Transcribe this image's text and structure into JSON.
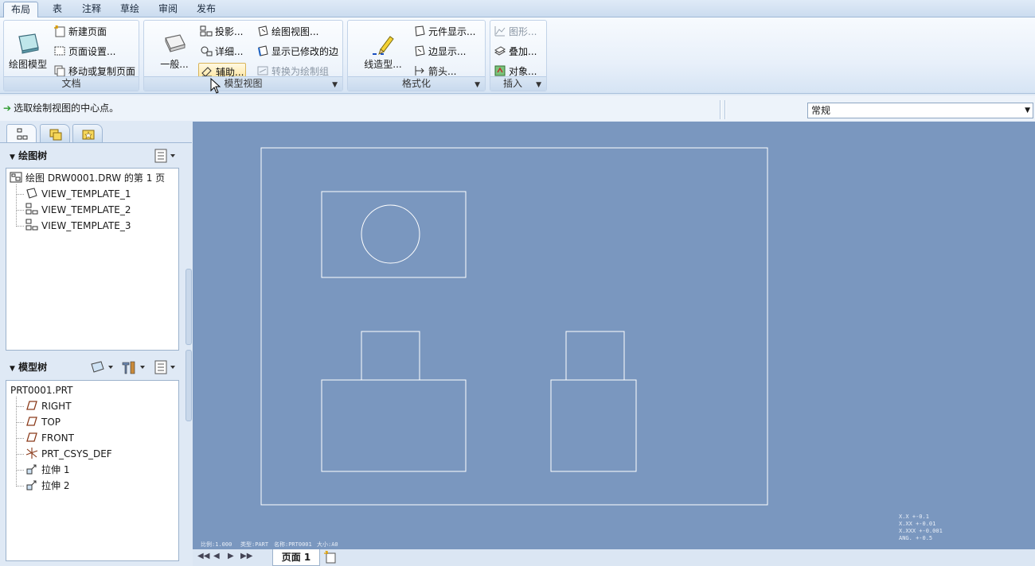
{
  "tabs": [
    "布局",
    "表",
    "注释",
    "草绘",
    "审阅",
    "发布"
  ],
  "ribbon": {
    "document": {
      "label": "文档",
      "big_button": "绘图模型",
      "new_page": "新建页面",
      "page_setup": "页面设置...",
      "move_copy_page": "移动或复制页面"
    },
    "model_views": {
      "label": "模型视图",
      "general": "一般...",
      "projection": "投影...",
      "detailed": "详细...",
      "auxiliary": "辅助...",
      "drawing_view": "绘图视图...",
      "show_modified_edges": "显示已修改的边",
      "convert_to_draft": "转换为绘制组"
    },
    "format": {
      "label": "格式化",
      "line_style": "线造型...",
      "component_display": "元件显示...",
      "edge_display": "边显示...",
      "arrow": "箭头..."
    },
    "insert": {
      "label": "插入",
      "graphics": "图形...",
      "overlay": "叠加...",
      "object": "对象..."
    }
  },
  "message": "选取绘制视图的中心点。",
  "filter_select": "常规",
  "drawing_tree": {
    "title": "绘图树",
    "root": "绘图 DRW0001.DRW 的第 1 页",
    "items": [
      "VIEW_TEMPLATE_1",
      "VIEW_TEMPLATE_2",
      "VIEW_TEMPLATE_3"
    ]
  },
  "model_tree": {
    "title": "模型树",
    "root": "PRT0001.PRT",
    "items": [
      "RIGHT",
      "TOP",
      "FRONT",
      "PRT_CSYS_DEF",
      "拉伸 1",
      "拉伸 2"
    ]
  },
  "canvas": {
    "footer_left": [
      "比例:1.000",
      "类型:PART",
      "名称:PRT0001",
      "大小:A0"
    ],
    "tolerance": [
      "X.X   +-0.1",
      "X.XX  +-0.01",
      "X.XXX +-0.001",
      "ANG.  +-0.5"
    ]
  },
  "page_tab": "页面 1",
  "colors": {
    "canvas": "#7a97bf",
    "ribbon_bg": "#e8f0fa",
    "line": "#ffffff"
  }
}
